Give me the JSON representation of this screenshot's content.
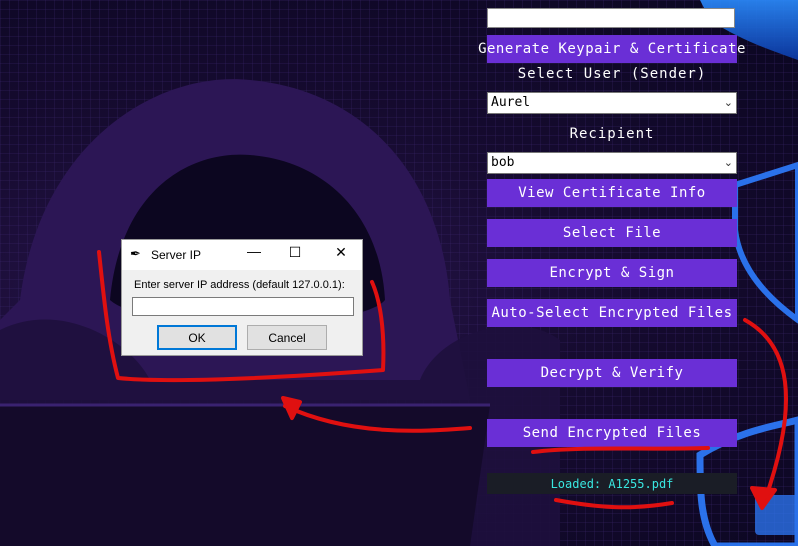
{
  "colors": {
    "accent": "#6a2fd6",
    "status_text": "#39e6e0",
    "annotation": "#e01010"
  },
  "panel": {
    "key_entry_value": "",
    "generate_button": "Generate Keypair & Certificate",
    "select_user_label": "Select User (Sender)",
    "user_combo_value": "Aurel",
    "recipient_label": "Recipient",
    "recipient_combo_value": "bob",
    "view_cert_button": "View Certificate Info",
    "select_file_button": "Select File",
    "encrypt_sign_button": "Encrypt & Sign",
    "auto_select_button": "Auto-Select Encrypted Files",
    "decrypt_verify_button": "Decrypt & Verify",
    "send_button": "Send Encrypted Files",
    "status_text": "Loaded: A1255.pdf"
  },
  "dialog": {
    "title": "Server IP",
    "prompt": "Enter server IP address (default 127.0.0.1):",
    "input_value": "",
    "ok_label": "OK",
    "cancel_label": "Cancel",
    "icons": {
      "app": "feather-icon",
      "minimize": "minimize-icon",
      "maximize": "maximize-icon",
      "close": "close-icon"
    }
  }
}
